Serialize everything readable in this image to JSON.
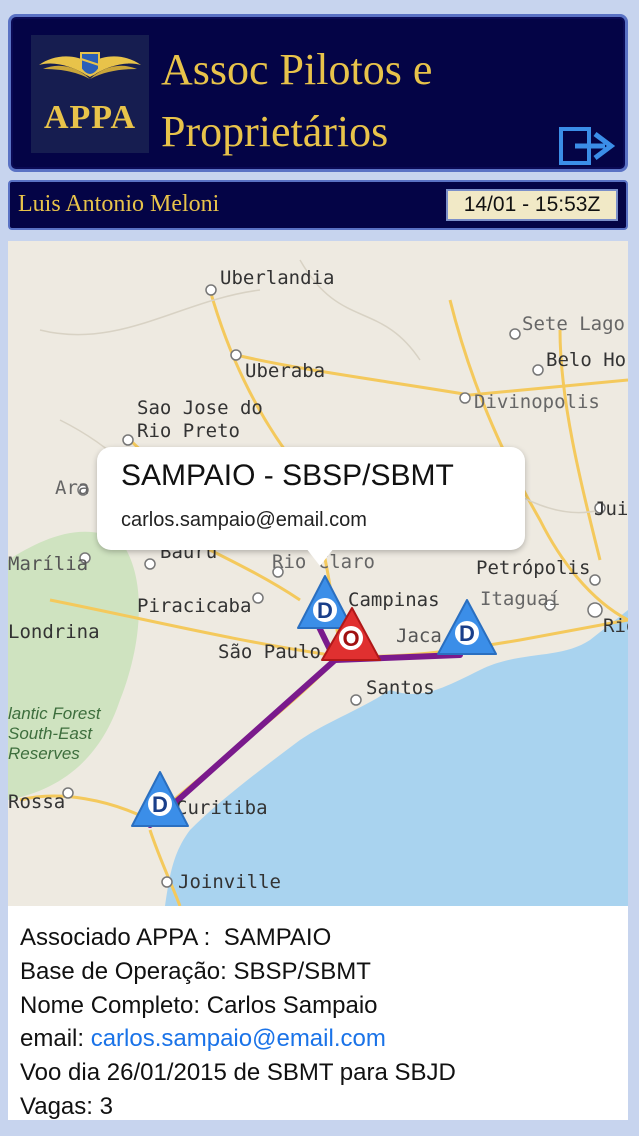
{
  "header": {
    "logo_text": "APPA",
    "title_line1": "Assoc Pilotos e",
    "title_line2": "Proprietários"
  },
  "userbar": {
    "user_name": "Luis Antonio Meloni",
    "datetime": "14/01 - 15:53Z"
  },
  "map": {
    "cities": [
      "Uberlandia",
      "Uberaba",
      "Sete Lago",
      "Belo Ho",
      "Divinopolis",
      "Sao Jose do",
      "Rio Preto",
      "Ara",
      "Juiz",
      "Marília",
      "Bauru",
      "Rio Claro",
      "Petrópolis",
      "Itaguaí",
      "Rio",
      "Londrina",
      "Piracicaba",
      "Campinas",
      "Jaca",
      "São Paulo",
      "Santos",
      "Rossa",
      "Curitiba",
      "Joinville"
    ],
    "reserve_label_lines": [
      "lantic Forest",
      "South-East",
      "Reserves"
    ],
    "markers": [
      {
        "label": "D",
        "type": "destination"
      },
      {
        "label": "O",
        "type": "origin"
      },
      {
        "label": "D",
        "type": "destination"
      },
      {
        "label": "D",
        "type": "destination"
      }
    ],
    "callout": {
      "title": "SAMPAIO - SBSP/SBMT",
      "subtitle": "carlos.sampaio@email.com"
    }
  },
  "info": {
    "associado_label": "Associado APPA :",
    "associado_value": "SAMPAIO",
    "base_label": "Base de Operação:",
    "base_value": "SBSP/SBMT",
    "nome_label": "Nome Completo:",
    "nome_value": "Carlos Sampaio",
    "email_label": "email:",
    "email_value": "carlos.sampaio@email.com",
    "voo_text": "Voo dia 26/01/2015 de SBMT para SBJD",
    "vagas_label": "Vagas:",
    "vagas_value": "3"
  },
  "colors": {
    "header_bg": "#040446",
    "gold": "#e8c34a",
    "route": "#7a1a8c",
    "origin_marker": "#e03030",
    "destination_marker": "#3b8ee8",
    "link": "#1a73e8"
  }
}
